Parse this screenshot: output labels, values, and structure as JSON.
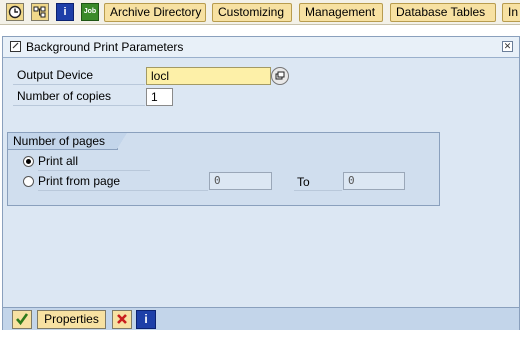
{
  "toolbar": {
    "icons": [
      "clock-icon",
      "hierarchy-icon",
      "info-icon",
      "job-icon"
    ],
    "job_icon_text": "Job",
    "buttons": [
      "Archive Directory",
      "Customizing",
      "Management",
      "Database Tables",
      "In"
    ]
  },
  "dialog": {
    "title": "Background Print Parameters",
    "output_device_label": "Output Device",
    "output_device_value": "locl",
    "copies_label": "Number of copies",
    "copies_value": "1",
    "pages_group_title": "Number of pages",
    "print_all_label": "Print all",
    "print_from_label": "Print from page",
    "from_value": "0",
    "to_label": "To",
    "to_value": "0",
    "selected_option": "print_all"
  },
  "footer": {
    "properties_label": "Properties",
    "icons": [
      "checkmark-icon",
      "cancel-icon",
      "info-icon"
    ]
  },
  "colors": {
    "dialog_bg": "#dce7f3",
    "button_bg": "#f7e1a2",
    "required_field": "#fdf0a8"
  }
}
